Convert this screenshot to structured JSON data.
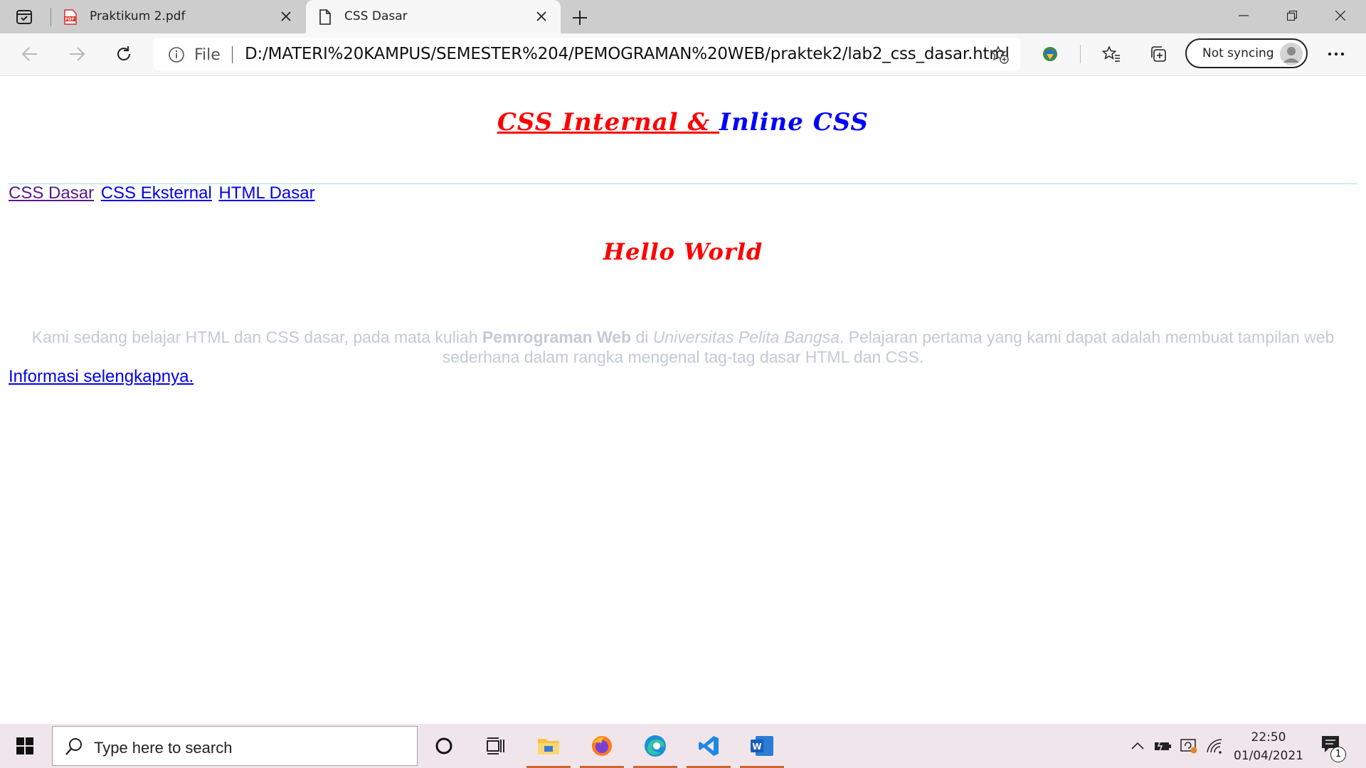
{
  "browser": {
    "tabs": [
      {
        "title": "Praktikum 2.pdf",
        "icon": "pdf-icon",
        "active": false
      },
      {
        "title": "CSS Dasar",
        "icon": "page-icon",
        "active": true
      }
    ],
    "address": {
      "scheme_label": "File",
      "url": "D:/MATERI%20KAMPUS/SEMESTER%204/PEMOGRAMAN%20WEB/praktek2/lab2_css_dasar.html"
    },
    "profile": {
      "sync_label": "Not syncing"
    }
  },
  "page": {
    "heading_red": "CSS Internal & ",
    "heading_blue": "Inline CSS",
    "nav_links": [
      "CSS Dasar",
      "CSS Eksternal",
      "HTML Dasar"
    ],
    "hello": "Hello World",
    "paragraph": {
      "part1": "Kami sedang belajar HTML dan CSS dasar, pada mata kuliah ",
      "bold": "Pemrograman Web",
      "part2": " di ",
      "italic": "Universitas Pelita Bangsa",
      "part3": ". Pelajaran pertama yang kami dapat adalah membuat tampilan web sederhana dalam rangka mengenal tag-tag dasar HTML dan CSS."
    },
    "more_link": "Informasi selengkapnya."
  },
  "taskbar": {
    "search_placeholder": "Type here to search",
    "time": "22:50",
    "date": "01/04/2021",
    "notification_count": "1"
  },
  "colors": {
    "heading_red": "#ff0000",
    "heading_blue": "#0000ff",
    "paragraph": "#c2cad6",
    "visited_link": "#551a8b",
    "link": "#0000ee"
  }
}
